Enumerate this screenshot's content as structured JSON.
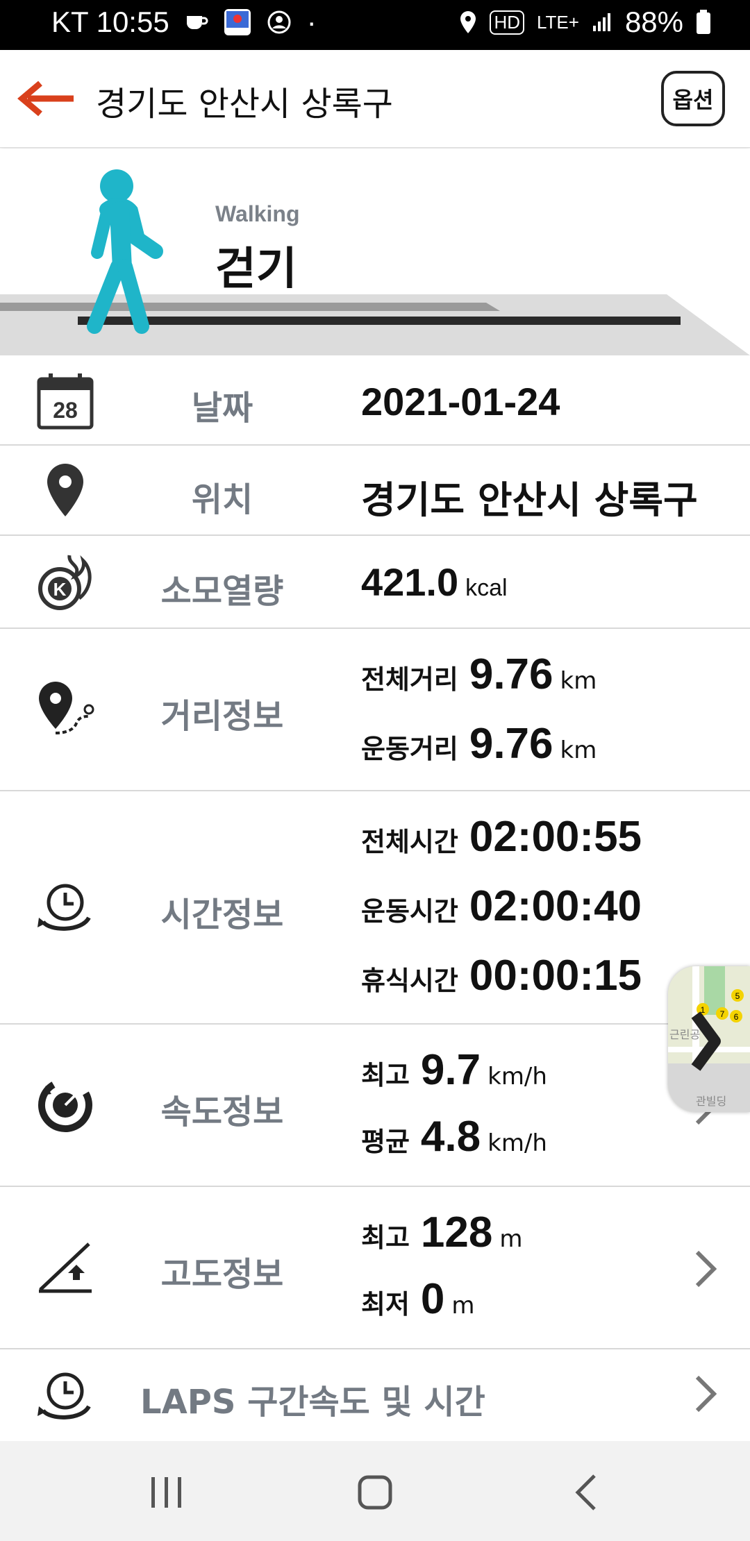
{
  "status_bar": {
    "carrier_time": "KT 10:55",
    "dot": "·",
    "network_hd": "HD",
    "network_lte": "LTE+",
    "battery": "88%",
    "icons": [
      "coffee-icon",
      "app-notification-icon",
      "account-icon",
      "location-icon",
      "hd-voice-icon",
      "lte-icon",
      "signal-icon",
      "battery-icon"
    ]
  },
  "header": {
    "title": "경기도 안산시 상록구",
    "option_label": "옵션"
  },
  "hero": {
    "activity_en": "Walking",
    "activity_ko": "걷기",
    "figure_color": "#1fb5c9"
  },
  "rows": {
    "date": {
      "label": "날짜",
      "value": "2021-01-24",
      "icon_text": "28"
    },
    "location": {
      "label": "위치",
      "value": "경기도 안산시 상록구"
    },
    "calories": {
      "label": "소모열량",
      "value": "421.0",
      "unit": "kcal",
      "icon_text": "K"
    },
    "distance": {
      "label": "거리정보",
      "total_label": "전체거리",
      "total_value": "9.76",
      "total_unit": "km",
      "exercise_label": "운동거리",
      "exercise_value": "9.76",
      "exercise_unit": "km"
    },
    "time": {
      "label": "시간정보",
      "total_label": "전체시간",
      "total_value": "02:00:55",
      "exercise_label": "운동시간",
      "exercise_value": "02:00:40",
      "rest_label": "휴식시간",
      "rest_value": "00:00:15"
    },
    "speed": {
      "label": "속도정보",
      "max_label": "최고",
      "max_value": "9.7",
      "max_unit": "km/h",
      "avg_label": "평균",
      "avg_value": "4.8",
      "avg_unit": "km/h"
    },
    "altitude": {
      "label": "고도정보",
      "max_label": "최고",
      "max_value": "128",
      "max_unit": "m",
      "min_label": "최저",
      "min_value": "0",
      "min_unit": "m"
    },
    "laps": {
      "label": "LAPS 구간속도 및 시간"
    }
  },
  "map_thumb": {
    "text_top": "근린공",
    "text_bottom": "관빌딩",
    "markers": [
      "1",
      "7",
      "6",
      "5"
    ]
  },
  "colors": {
    "accent": "#e0401e",
    "label_gray": "#737a83",
    "divider": "#d8d8d8"
  }
}
